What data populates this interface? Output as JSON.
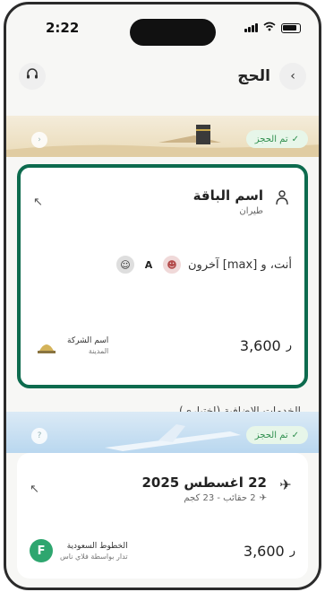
{
  "status_bar": {
    "time": "2:22"
  },
  "header": {
    "title": "الحج",
    "back_icon": "chevron-right-icon",
    "support_icon": "headset-icon"
  },
  "package_card": {
    "banner_badge": "تم الحجز",
    "name": "اسم الباقة",
    "type": "طيران",
    "travelers_text": "أنت، و [max] آخرون",
    "avatar_letter": "A",
    "price": "3,600",
    "currency_icon": "riyal-icon",
    "company_name": "اسم الشركة",
    "company_city": "المدينة"
  },
  "additional_services": {
    "title": "الخدمات الإضافية (اختياري)"
  },
  "flight_card": {
    "banner_badge": "تم الحجز",
    "date": "22 اغسطس 2025",
    "baggage": "2 حقائب - 23 كجم",
    "price": "3,600",
    "airline_name": "الخطوط السعودية",
    "airline_sub": "تدار بواسطة فلاي ناس",
    "airline_logo_letter": "F"
  },
  "colors": {
    "accent": "#0d6b4e",
    "badge_bg": "#e7f6e9",
    "badge_text": "#2f8f4e"
  }
}
